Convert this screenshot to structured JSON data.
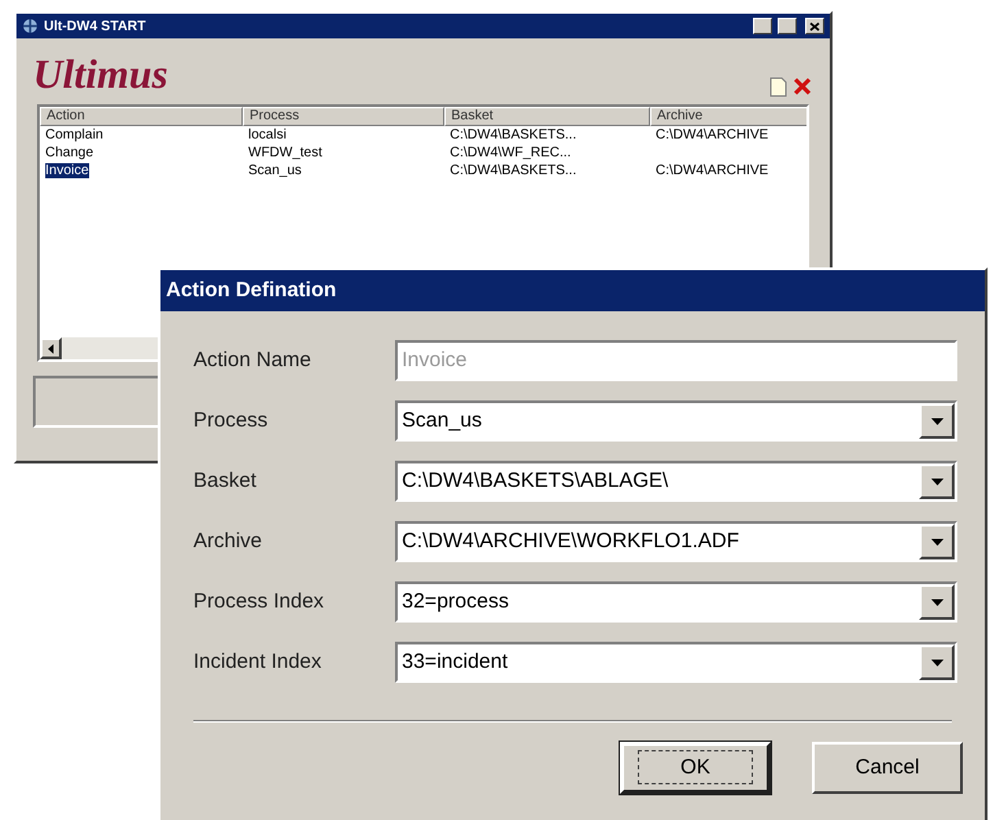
{
  "main_window": {
    "title": "Ult-DW4 START",
    "logo": "Ultimus",
    "table": {
      "columns": [
        "Action",
        "Process",
        "Basket",
        "Archive"
      ],
      "rows": [
        {
          "cells": [
            "Complain",
            "localsi",
            "C:\\DW4\\BASKETS...",
            "C:\\DW4\\ARCHIVE"
          ],
          "selected": false
        },
        {
          "cells": [
            "Change",
            "WFDW_test",
            "C:\\DW4\\WF_REC...",
            ""
          ],
          "selected": false
        },
        {
          "cells": [
            "Invoice",
            "Scan_us",
            "C:\\DW4\\BASKETS...",
            "C:\\DW4\\ARCHIVE"
          ],
          "selected": true
        }
      ]
    }
  },
  "dialog": {
    "title": "Action Defination",
    "fields": [
      {
        "label": "Action Name",
        "value": "Invoice",
        "kind": "text",
        "disabled": true
      },
      {
        "label": "Process",
        "value": "Scan_us",
        "kind": "dropdown",
        "disabled": false
      },
      {
        "label": "Basket",
        "value": "C:\\DW4\\BASKETS\\ABLAGE\\",
        "kind": "dropdown",
        "disabled": false
      },
      {
        "label": "Archive",
        "value": "C:\\DW4\\ARCHIVE\\WORKFLO1.ADF",
        "kind": "dropdown",
        "disabled": false
      },
      {
        "label": "Process Index",
        "value": "32=process",
        "kind": "dropdown",
        "disabled": false
      },
      {
        "label": "Incident Index",
        "value": "33=incident",
        "kind": "dropdown",
        "disabled": false
      }
    ],
    "buttons": [
      {
        "label": "OK",
        "default": true
      },
      {
        "label": "Cancel",
        "default": false
      }
    ]
  }
}
